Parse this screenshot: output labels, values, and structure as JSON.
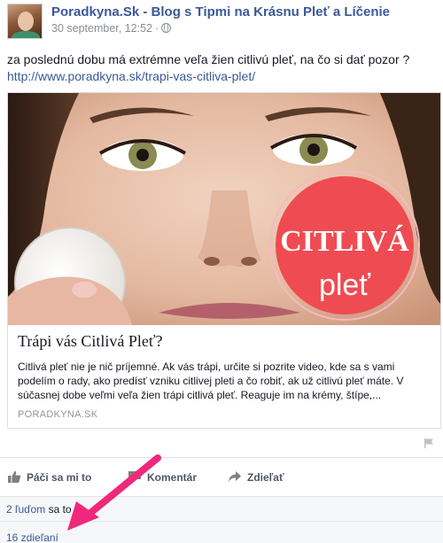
{
  "post": {
    "page_name": "Poradkyna.Sk - Blog s Tipmi na Krásnu Pleť a Líčenie",
    "date": "30 september, 12:52",
    "separator": "·",
    "text": "za poslednú dobu má extrémne veľa žien citlivú pleť, na čo si dať pozor ?",
    "link": "http://www.poradkyna.sk/trapi-vas-citliva-plet/"
  },
  "card": {
    "image_badge_line1": "CITLIVÁ",
    "image_badge_line2": "pleť",
    "title": "Trápi vás Citlivá Pleť?",
    "description": "Citlivá pleť nie je nič príjemné. Ak vás trápi, určite si pozrite video, kde sa s vami podelím o rady, ako predísť vzniku citlivej pleti a čo robiť, ak už citlivú pleť máte. V súčasnej dobe veľmi veľa žien trápi citlivá pleť. Reaguje im na krémy, štípe,...",
    "source": "PORADKYNA.SK"
  },
  "actions": {
    "like": "Páči sa mi to",
    "comment": "Komentár",
    "share": "Zdieľať"
  },
  "engagement": {
    "likes_count": "2 ľuďom",
    "likes_suffix": " sa to p",
    "shares": "16 zdieľaní"
  },
  "colors": {
    "link_blue": "#3b5998",
    "badge_red": "#ef4b52",
    "annotation_pink": "#f0287b"
  },
  "icons": {
    "globe": "globe-icon",
    "flag": "flag-icon",
    "like": "thumbs-up-icon",
    "comment": "speech-bubble-icon",
    "share": "share-arrow-icon"
  }
}
